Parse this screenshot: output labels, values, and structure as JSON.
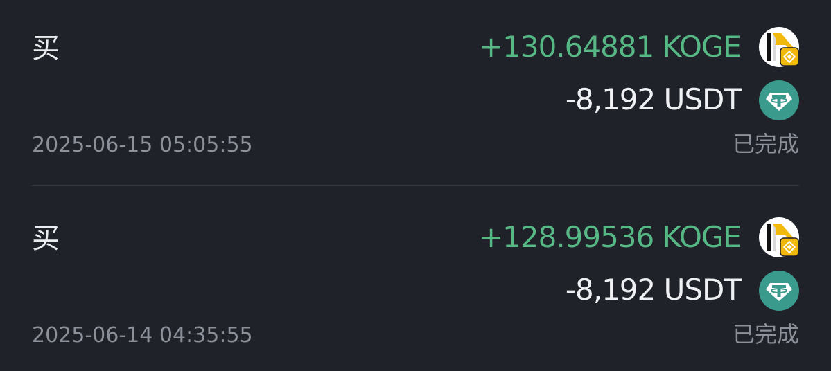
{
  "colors": {
    "background": "#1f2229",
    "positive": "#56b884",
    "primary_text": "#eef0f3",
    "secondary_text": "#8b9099",
    "usdt_teal": "#3a9a8c",
    "bnb_gold": "#f0b90b"
  },
  "transactions": [
    {
      "side": "买",
      "received": "+130.64881 KOGE",
      "received_icon": "koge-bnb-token-icon",
      "paid": "-8,192 USDT",
      "paid_icon": "usdt-tether-icon",
      "timestamp": "2025-06-15 05:05:55",
      "status": "已完成"
    },
    {
      "side": "买",
      "received": "+128.99536 KOGE",
      "received_icon": "koge-bnb-token-icon",
      "paid": "-8,192 USDT",
      "paid_icon": "usdt-tether-icon",
      "timestamp": "2025-06-14 04:35:55",
      "status": "已完成"
    }
  ]
}
